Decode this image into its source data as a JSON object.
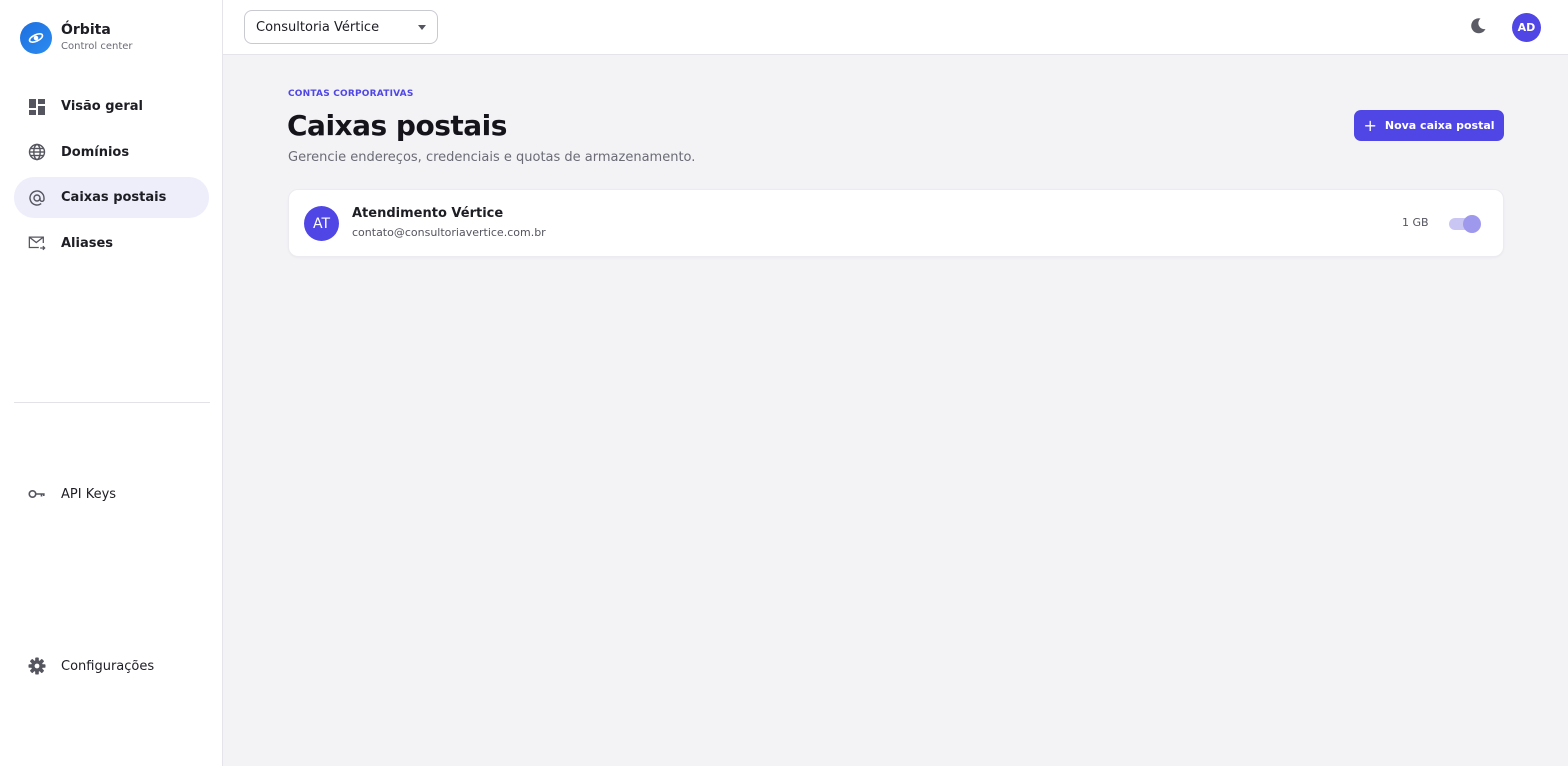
{
  "brand": {
    "name": "Órbita",
    "subtitle": "Control center",
    "logo_icon": "orbit-eye-icon",
    "color": "#1d6fe0"
  },
  "sidebar": {
    "items": [
      {
        "label": "Visão geral",
        "icon": "dashboard-icon",
        "active": false
      },
      {
        "label": "Domínios",
        "icon": "globe-icon",
        "active": false
      },
      {
        "label": "Caixas postais",
        "icon": "at-sign-icon",
        "active": true
      },
      {
        "label": "Aliases",
        "icon": "mail-forward-icon",
        "active": false
      }
    ],
    "api_keys": {
      "label": "API Keys",
      "icon": "key-icon"
    },
    "settings": {
      "label": "Configurações",
      "icon": "gear-icon"
    }
  },
  "topbar": {
    "org_select": {
      "value": "Consultoria Vértice",
      "icon": "caret-down-icon"
    },
    "theme_toggle": {
      "icon": "moon-icon"
    },
    "user_avatar": {
      "initials": "AD"
    }
  },
  "main": {
    "eyebrow": "CONTAS CORPORATIVAS",
    "title": "Caixas postais",
    "description": "Gerencie endereços, credenciais e quotas de armazenamento.",
    "new_button": {
      "label": "Nova caixa postal",
      "icon": "plus-icon"
    },
    "mailboxes": [
      {
        "initials": "AT",
        "name": "Atendimento Vértice",
        "email": "contato@consultoriavertice.com.br",
        "quota": "1 GB",
        "enabled": true
      }
    ]
  },
  "colors": {
    "accent": "#4f46e5",
    "background": "#f3f3f6",
    "active_nav": "#eeeefb"
  }
}
